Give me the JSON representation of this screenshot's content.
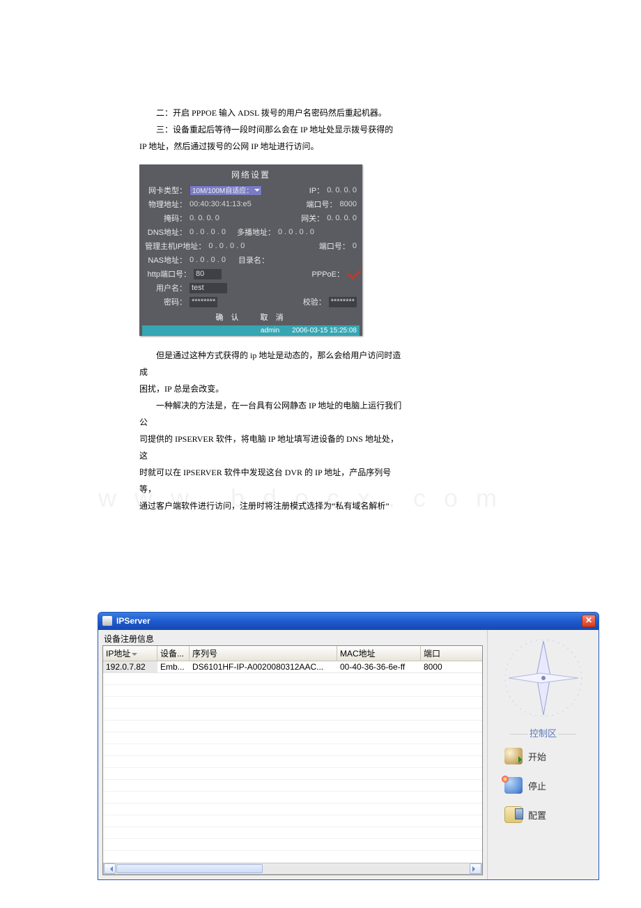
{
  "doc": {
    "p1": "二：开启 PPPOE 输入 ADSL 拨号的用户名密码然后重起机器。",
    "p2": "三：设备重起后等待一段时间那么会在 IP 地址处显示拨号获得的",
    "p3": "IP 地址，然后通过拨号的公网 IP 地址进行访问。"
  },
  "netpanel": {
    "title": "网络设置",
    "labels": {
      "nic_type": "网卡类型：",
      "ip": "IP：",
      "mac": "物理地址：",
      "port": "端口号：",
      "mask": "掩码：",
      "gateway": "网关：",
      "dns": "DNS地址：",
      "multicast": "多播地址：",
      "admin_ip": "管理主机IP地址：",
      "admin_port": "端口号：",
      "nas": "NAS地址：",
      "dir": "目录名：",
      "http_port": "http端口号：",
      "pppoe": "PPPoE：",
      "user": "用户名：",
      "password": "密码：",
      "verify": "校验：",
      "confirm": "确  认",
      "cancel": "取  消"
    },
    "values": {
      "nic_type": "10M/100M自适应：",
      "ip": "0. 0. 0. 0",
      "mac": "00:40:30:41:13:e5",
      "port": "8000",
      "mask": "0. 0. 0. 0",
      "gateway": "0. 0. 0. 0",
      "dns": "0  . 0  . 0  . 0",
      "multicast": "0  . 0  . 0  . 0",
      "admin_ip": "0  . 0  . 0  . 0",
      "admin_port": "0",
      "nas": "0  . 0  . 0  . 0",
      "dir": "",
      "http_port": "80",
      "user": "test",
      "password": "********",
      "verify": "********"
    },
    "status": {
      "user": "admin",
      "time": "2006-03-15  15:25:08"
    }
  },
  "doc2": {
    "p1": "但是通过这种方式获得的 ip 地址是动态的，那么会给用户访问时造成",
    "p2": "困扰，IP 总是会改变。",
    "p3": "一种解决的方法是，在一台具有公网静态 IP 地址的电脑上运行我们公",
    "p4": "司提供的 IPSERVER 软件，将电脑 IP 地址填写进设备的 DNS 地址处，这",
    "p5": "时就可以在 IPSERVER 软件中发现这台 DVR 的 IP 地址，产品序列号等，",
    "p6": "通过客户端软件进行访问，注册时将注册模式选择为“私有域名解析”"
  },
  "watermark": "www.bdocx.com",
  "ipserver": {
    "title": "IPServer",
    "group": "设备注册信息",
    "columns": {
      "ip": "IP地址",
      "device": "设备...",
      "serial": "序列号",
      "mac": "MAC地址",
      "port": "端口"
    },
    "rows": [
      {
        "ip": "192.0.7.82",
        "device": "Emb...",
        "serial": "DS6101HF-IP-A0020080312AAC...",
        "mac": "00-40-36-36-6e-ff",
        "port": "8000"
      }
    ],
    "control": {
      "section": "控制区",
      "start": "开始",
      "stop": "停止",
      "config": "配置"
    }
  }
}
